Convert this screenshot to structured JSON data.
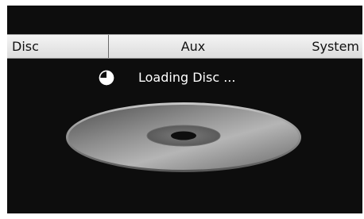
{
  "menu": {
    "items": [
      {
        "label": "Disc"
      },
      {
        "label": "Aux"
      },
      {
        "label": "System"
      }
    ]
  },
  "status": {
    "text": "Loading Disc ...",
    "icon": "loading-pie-icon"
  },
  "disc_image": {
    "icon": "disc-icon"
  }
}
